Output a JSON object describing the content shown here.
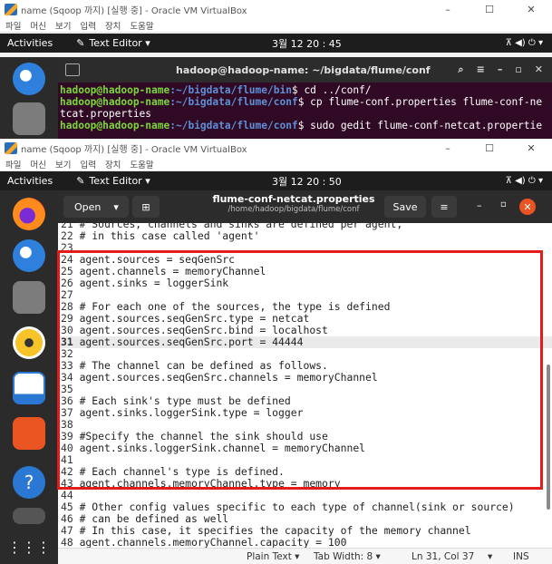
{
  "host_window_1": {
    "title": "name (Sqoop 까지) [실행 중] - Oracle VM VirtualBox",
    "menu": [
      "파일",
      "머신",
      "보기",
      "입력",
      "장치",
      "도움말"
    ],
    "controls": [
      "–",
      "☐",
      "✕"
    ]
  },
  "host_window_2": {
    "title": "name (Sqoop 까지) [실행 중] - Oracle VM VirtualBox",
    "menu": [
      "파일",
      "머신",
      "보기",
      "입력",
      "장치",
      "도움말"
    ],
    "controls": [
      "–",
      "☐",
      "✕"
    ]
  },
  "ubuntu_bar_1": {
    "activities": "Activities",
    "app": "Text Editor ▾",
    "clock": "3월 12 20 : 45",
    "tray": "⊼  ◀)  ⏻ ▾"
  },
  "ubuntu_bar_2": {
    "activities": "Activities",
    "app": "Text Editor ▾",
    "clock": "3월 12 20 : 50",
    "tray": "⊼  ◀)  ⏻ ▾"
  },
  "terminal": {
    "title": "hadoop@hadoop-name: ~/bigdata/flume/conf",
    "lines": [
      {
        "user": "hadoop@hadoop-name",
        "path": ":~/bigdata/flume/bin",
        "cmd": "$ cd ../conf/"
      },
      {
        "user": "hadoop@hadoop-name",
        "path": ":~/bigdata/flume/conf",
        "cmd": "$ cp flume-conf.properties flume-conf-ne"
      },
      {
        "user": "",
        "path": "",
        "cmd": "tcat.properties"
      },
      {
        "user": "hadoop@hadoop-name",
        "path": ":~/bigdata/flume/conf",
        "cmd": "$ sudo gedit flume-conf-netcat.propertie"
      }
    ]
  },
  "dock": {
    "icons": [
      "thunderbird-icon",
      "files-icon",
      "firefox-icon",
      "rhythmbox-icon",
      "writer-icon",
      "software-icon",
      "help-icon",
      "apps-grid-icon"
    ]
  },
  "editor": {
    "open_label": "Open",
    "file_name": "flume-conf-netcat.properties",
    "file_path": "/home/hadoop/bigdata/flume/conf",
    "save_label": "Save",
    "lines": [
      {
        "n": "21",
        "t": " # Sources, channels and sinks are defined per agent,"
      },
      {
        "n": "22",
        "t": " # in this case called 'agent'"
      },
      {
        "n": "23",
        "t": ""
      },
      {
        "n": "24",
        "t": " agent.sources = seqGenSrc"
      },
      {
        "n": "25",
        "t": " agent.channels = memoryChannel"
      },
      {
        "n": "26",
        "t": " agent.sinks = loggerSink"
      },
      {
        "n": "27",
        "t": ""
      },
      {
        "n": "28",
        "t": " # For each one of the sources, the type is defined"
      },
      {
        "n": "29",
        "t": " agent.sources.seqGenSrc.type = netcat"
      },
      {
        "n": "30",
        "t": " agent.sources.seqGenSrc.bind = localhost"
      },
      {
        "n": "31",
        "t": " agent.sources.seqGenSrc.port = 44444"
      },
      {
        "n": "32",
        "t": ""
      },
      {
        "n": "33",
        "t": " # The channel can be defined as follows."
      },
      {
        "n": "34",
        "t": " agent.sources.seqGenSrc.channels = memoryChannel"
      },
      {
        "n": "35",
        "t": ""
      },
      {
        "n": "36",
        "t": " # Each sink's type must be defined"
      },
      {
        "n": "37",
        "t": " agent.sinks.loggerSink.type = logger"
      },
      {
        "n": "38",
        "t": ""
      },
      {
        "n": "39",
        "t": " #Specify the channel the sink should use"
      },
      {
        "n": "40",
        "t": " agent.sinks.loggerSink.channel = memoryChannel"
      },
      {
        "n": "41",
        "t": ""
      },
      {
        "n": "42",
        "t": " # Each channel's type is defined."
      },
      {
        "n": "43",
        "t": " agent.channels.memoryChannel.type = memory"
      },
      {
        "n": "44",
        "t": ""
      },
      {
        "n": "45",
        "t": " # Other config values specific to each type of channel(sink or source)"
      },
      {
        "n": "46",
        "t": " # can be defined as well"
      },
      {
        "n": "47",
        "t": " # In this case, it specifies the capacity of the memory channel"
      },
      {
        "n": "48",
        "t": " agent.channels.memoryChannel.capacity = 100"
      }
    ],
    "current_line": "31",
    "status": {
      "syntax": "Plain Text ▾",
      "tab_width": "Tab Width: 8 ▾",
      "position": "Ln 31, Col 37",
      "mode_arrow": "▾",
      "mode": "INS"
    }
  },
  "colors": {
    "highlight": "#e21b1b",
    "ubuntu_orange": "#e95420",
    "terminal_bg": "#300a24"
  }
}
